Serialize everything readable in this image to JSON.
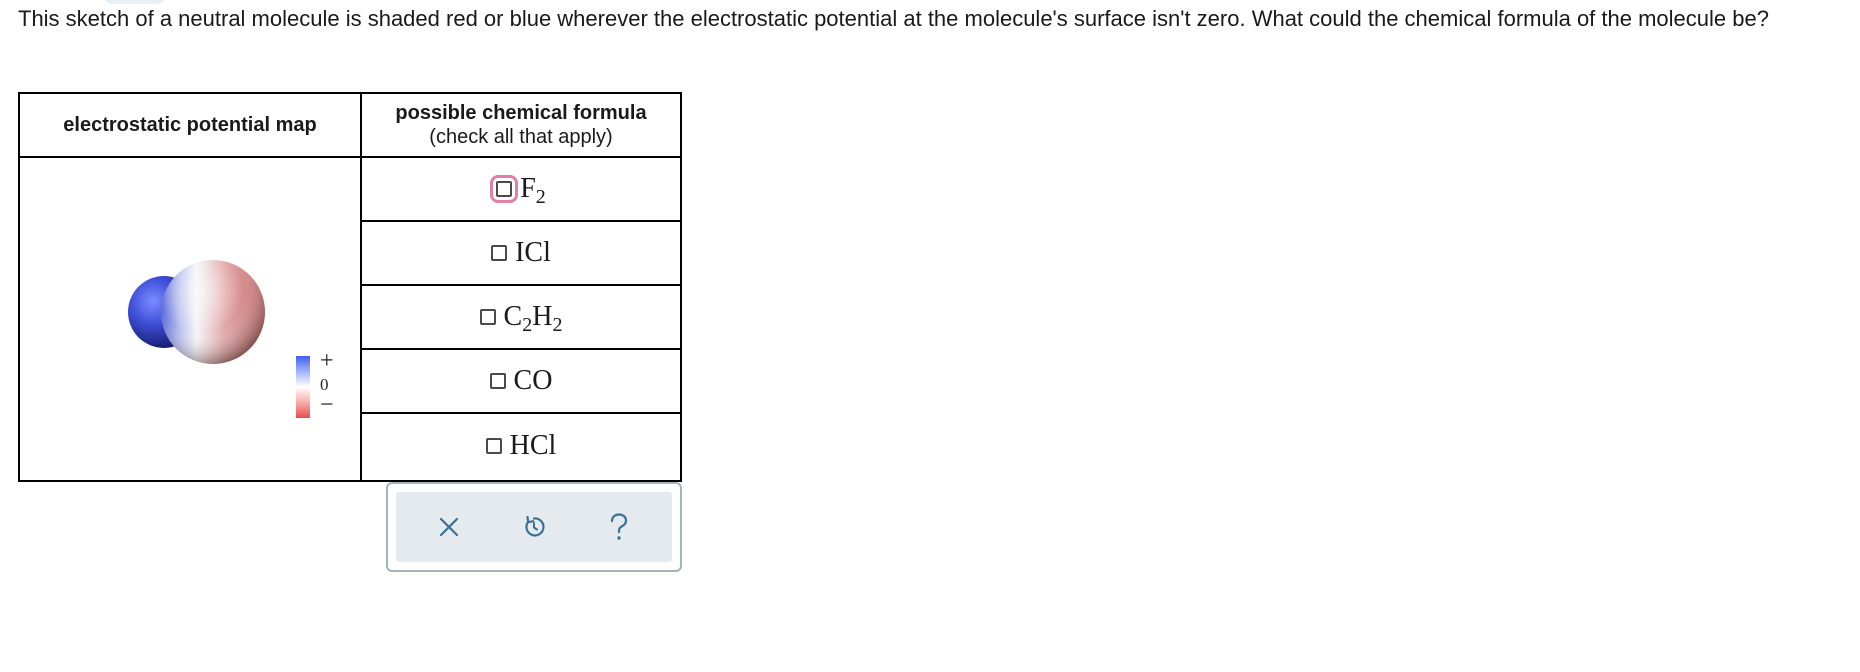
{
  "question": {
    "prompt_text": "This sketch of a neutral molecule is shaded red or blue wherever the electrostatic potential at the molecule's surface isn't zero. What could the chemical formula of the molecule be?"
  },
  "table": {
    "map_header": "electrostatic potential map",
    "formula_header": "possible chemical formula",
    "formula_subheader": "(check all that apply)"
  },
  "legend": {
    "plus": "+",
    "zero": "0",
    "minus": "−",
    "colors": {
      "positive": "#3d5ef0",
      "neutral": "#ffffff",
      "negative": "#e84b4b"
    }
  },
  "options": [
    {
      "id": "f2",
      "base": "F",
      "sub1": "2",
      "mid": "",
      "sub2": "",
      "checked": false,
      "focused": true
    },
    {
      "id": "icl",
      "base": "ICl",
      "sub1": "",
      "mid": "",
      "sub2": "",
      "checked": false,
      "focused": false
    },
    {
      "id": "c2h2",
      "base": "C",
      "sub1": "2",
      "mid": "H",
      "sub2": "2",
      "checked": false,
      "focused": false
    },
    {
      "id": "co",
      "base": "CO",
      "sub1": "",
      "mid": "",
      "sub2": "",
      "checked": false,
      "focused": false
    },
    {
      "id": "hcl",
      "base": "HCl",
      "sub1": "",
      "mid": "",
      "sub2": "",
      "checked": false,
      "focused": false
    }
  ],
  "toolbar": {
    "buttons": [
      {
        "icon": "close-icon",
        "action": "clear"
      },
      {
        "icon": "undo-icon",
        "action": "undo"
      },
      {
        "icon": "help-icon",
        "action": "help"
      }
    ],
    "accent_color": "#3a6f96"
  }
}
